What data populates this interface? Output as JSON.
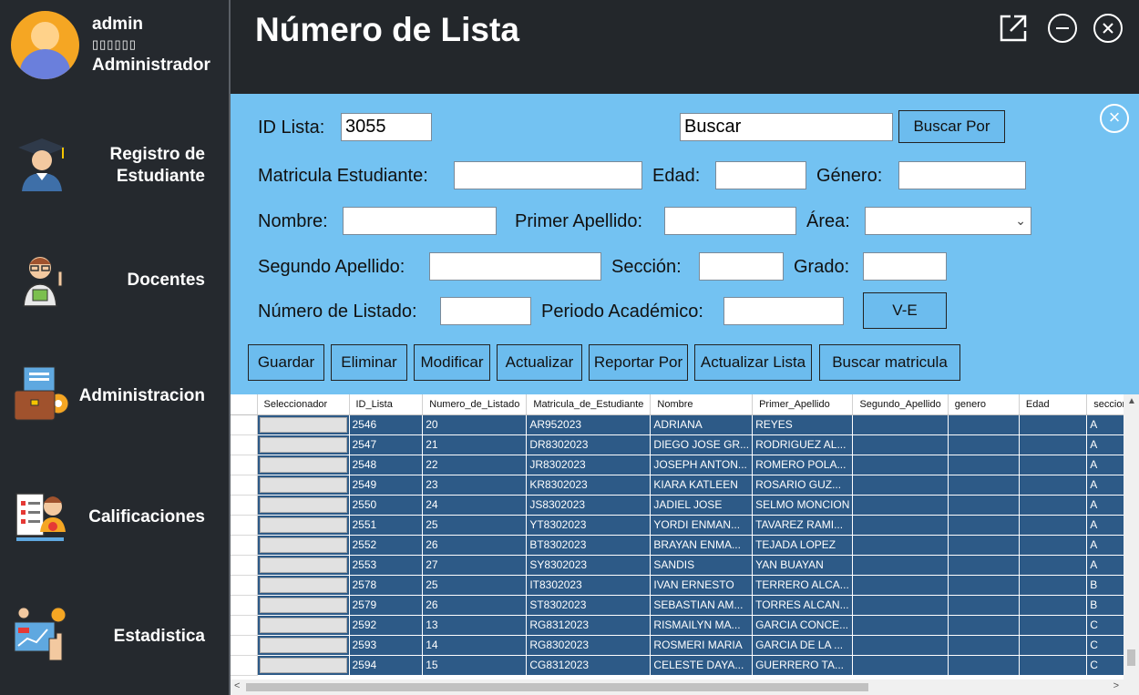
{
  "user": {
    "name": "admin",
    "subtitle": "▯▯▯▯▯▯",
    "role": "Administrador"
  },
  "nav": {
    "registro": "Registro de Estudiante",
    "docentes": "Docentes",
    "administracion": "Administracion",
    "calificaciones": "Calificaciones",
    "estadistica": "Estadistica"
  },
  "header": {
    "title": "Número de Lista"
  },
  "form": {
    "id_lista_label": "ID Lista:",
    "id_lista_value": "3055",
    "buscar_value": "Buscar",
    "buscar_por_button": "Buscar Por",
    "matricula_label": "Matricula Estudiante:",
    "edad_label": "Edad:",
    "genero_label": "Género:",
    "nombre_label": "Nombre:",
    "primer_apellido_label": "Primer Apellido:",
    "area_label": "Área:",
    "segundo_apellido_label": "Segundo Apellido:",
    "seccion_label": "Sección:",
    "grado_label": "Grado:",
    "numero_listado_label": "Número de Listado:",
    "periodo_label": "Periodo Académico:",
    "ve_button": "V-E",
    "close_symbol": "×"
  },
  "actions": {
    "guardar": "Guardar",
    "eliminar": "Eliminar",
    "modificar": "Modificar",
    "actualizar": "Actualizar",
    "reportar": "Reportar Por",
    "actualizar_lista": "Actualizar Lista",
    "buscar_matricula": "Buscar matricula"
  },
  "grid": {
    "columns": [
      "Seleccionador",
      "ID_Lista",
      "Numero_de_Listado",
      "Matricula_de_Estudiante",
      "Nombre",
      "Primer_Apellido",
      "Segundo_Apellido",
      "genero",
      "Edad",
      "seccion"
    ],
    "rows": [
      [
        "",
        "2546",
        "20",
        "AR952023",
        "ADRIANA",
        "REYES",
        "",
        "",
        "",
        "A"
      ],
      [
        "",
        "2547",
        "21",
        "DR8302023",
        "DIEGO JOSE GR...",
        "RODRIGUEZ AL...",
        "",
        "",
        "",
        "A"
      ],
      [
        "",
        "2548",
        "22",
        "JR8302023",
        "JOSEPH ANTON...",
        "ROMERO POLA...",
        "",
        "",
        "",
        "A"
      ],
      [
        "",
        "2549",
        "23",
        "KR8302023",
        "KIARA KATLEEN",
        "ROSARIO GUZ...",
        "",
        "",
        "",
        "A"
      ],
      [
        "",
        "2550",
        "24",
        "JS8302023",
        "JADIEL JOSE",
        "SELMO MONCION",
        "",
        "",
        "",
        "A"
      ],
      [
        "",
        "2551",
        "25",
        "YT8302023",
        "YORDI ENMAN...",
        "TAVAREZ RAMI...",
        "",
        "",
        "",
        "A"
      ],
      [
        "",
        "2552",
        "26",
        "BT8302023",
        "BRAYAN ENMA...",
        "TEJADA LOPEZ",
        "",
        "",
        "",
        "A"
      ],
      [
        "",
        "2553",
        "27",
        "SY8302023",
        "SANDIS",
        "YAN BUAYAN",
        "",
        "",
        "",
        "A"
      ],
      [
        "",
        "2578",
        "25",
        "IT8302023",
        "IVAN ERNESTO",
        "TERRERO ALCA...",
        "",
        "",
        "",
        "B"
      ],
      [
        "",
        "2579",
        "26",
        "ST8302023",
        "SEBASTIAN AM...",
        "TORRES ALCAN...",
        "",
        "",
        "",
        "B"
      ],
      [
        "",
        "2592",
        "13",
        "RG8312023",
        "RISMAILYN MA...",
        "GARCIA CONCE...",
        "",
        "",
        "",
        "C"
      ],
      [
        "",
        "2593",
        "14",
        "RG8302023",
        "ROSMERI MARIA",
        "GARCIA DE LA ...",
        "",
        "",
        "",
        "C"
      ],
      [
        "",
        "2594",
        "15",
        "CG8312023",
        "CELESTE DAYA...",
        "GUERRERO TA...",
        "",
        "",
        "",
        "C"
      ]
    ]
  },
  "colors": {
    "sidebar": "#25292e",
    "form_bg": "#73c2f2",
    "row_bg": "#2d5a87"
  }
}
